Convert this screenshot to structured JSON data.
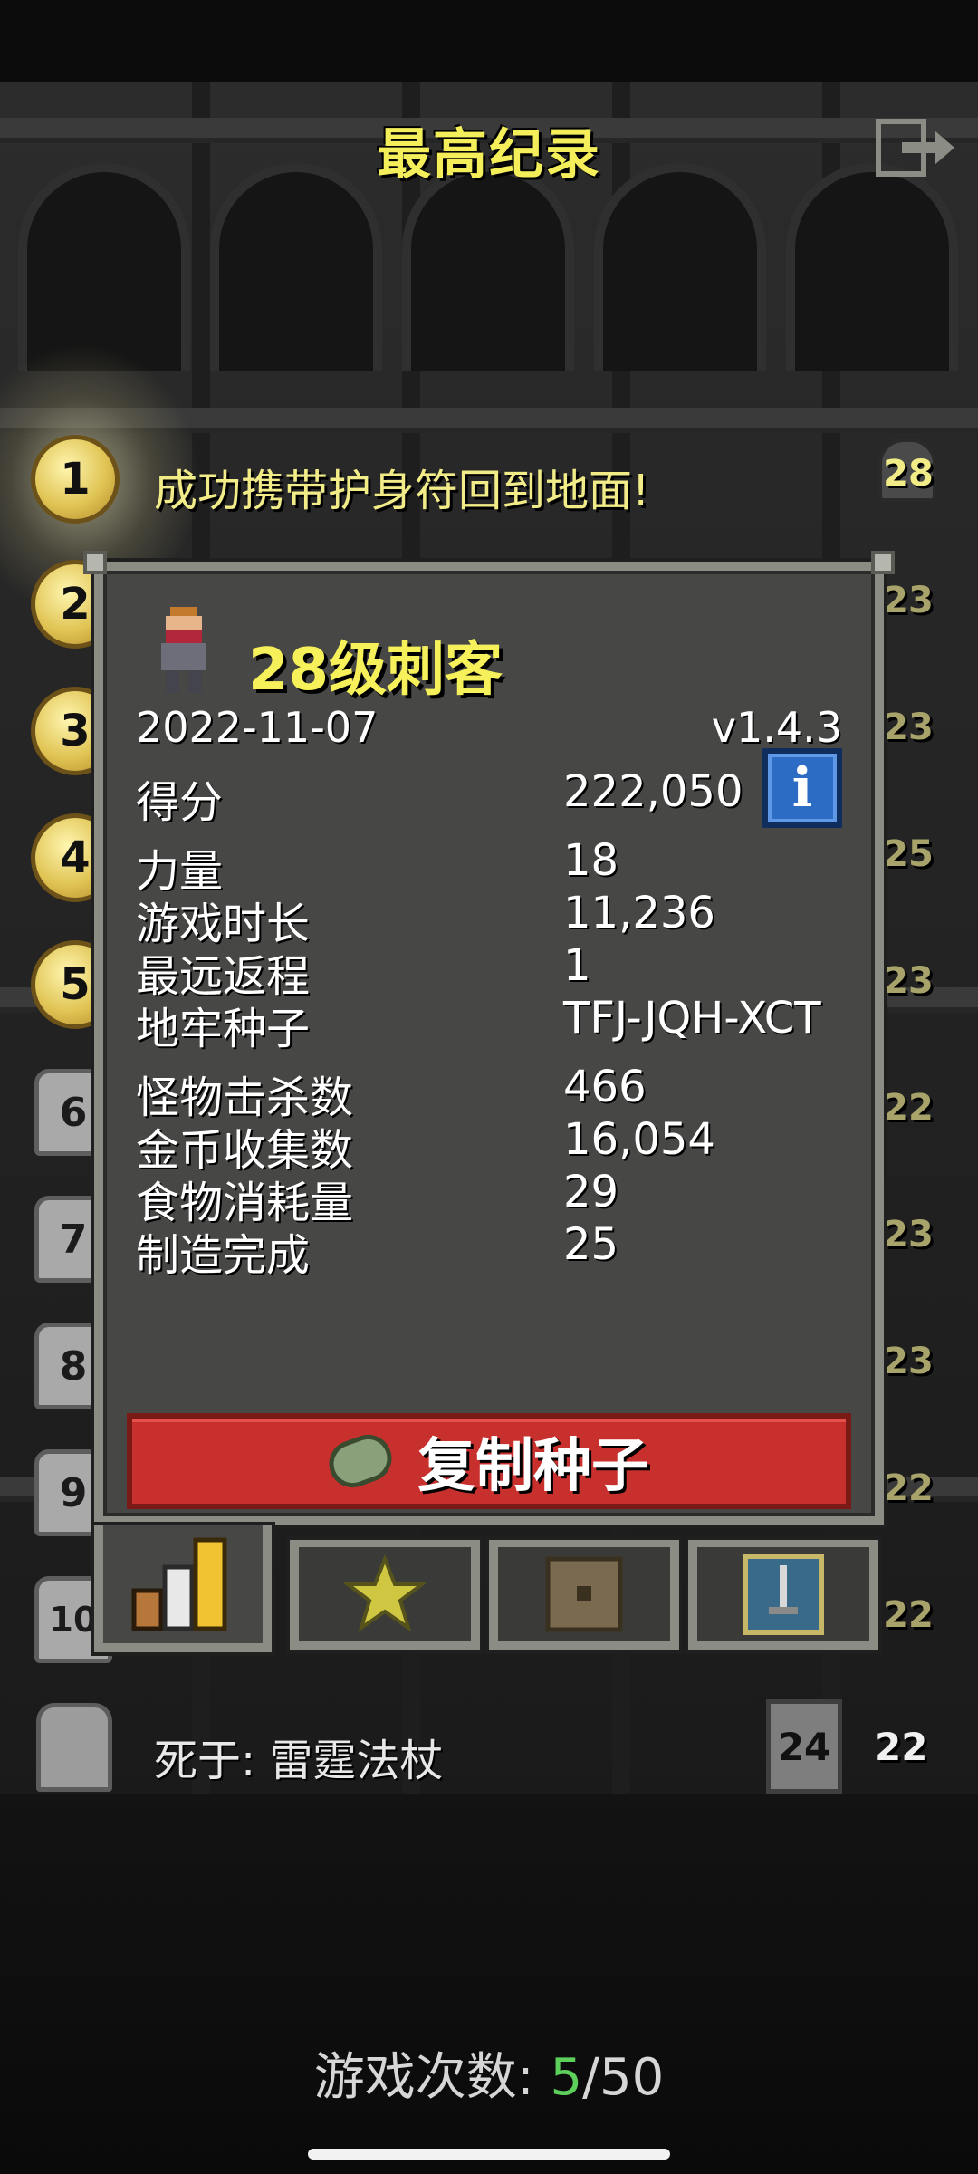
{
  "header": {
    "title": "最高纪录",
    "exit_icon": "exit-icon"
  },
  "records": {
    "ranks": [
      "1",
      "2",
      "3",
      "4",
      "5",
      "6",
      "7",
      "8",
      "9",
      "10"
    ],
    "first_record_text": "成功携带护身符回到地面!",
    "levels": [
      "28",
      "23",
      "23",
      "25",
      "23",
      "22",
      "23",
      "23",
      "22",
      "22"
    ]
  },
  "detail": {
    "hero_title": "28级刺客",
    "date": "2022-11-07",
    "version": "v1.4.3",
    "score_label": "得分",
    "score_value": "222,050",
    "stats_group1": [
      {
        "label": "力量",
        "value": "18"
      },
      {
        "label": "游戏时长",
        "value": "11,236"
      },
      {
        "label": "最远返程",
        "value": "1"
      },
      {
        "label": "地牢种子",
        "value": "TFJ-JQH-XCT"
      }
    ],
    "stats_group2": [
      {
        "label": "怪物击杀数",
        "value": "466"
      },
      {
        "label": "金币收集数",
        "value": "16,054"
      },
      {
        "label": "食物消耗量",
        "value": "29"
      },
      {
        "label": "制造完成",
        "value": "25"
      }
    ],
    "copy_seed_label": "复制种子",
    "tabs": [
      "stats-icon",
      "badge-star-icon",
      "chest-icon",
      "sword-icon"
    ]
  },
  "footer_record": {
    "death_text": "死于:  雷霆法杖",
    "depth": "24",
    "level": "22"
  },
  "games": {
    "label": "游戏次数:",
    "current": "5",
    "separator": "/",
    "max": "50"
  },
  "colors": {
    "title_yellow": "#f6f05a",
    "button_red": "#c7302c",
    "info_blue": "#2d6cc4",
    "games_green": "#5cd05a"
  }
}
